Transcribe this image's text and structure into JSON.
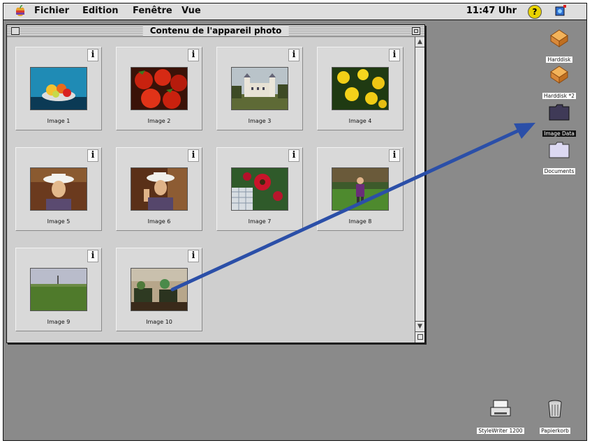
{
  "menubar": {
    "menus": [
      "Fichier",
      "Edition",
      "Fenêtre",
      "Vue"
    ],
    "clock": "11:47 Uhr",
    "help_glyph": "?"
  },
  "window": {
    "title": "Contenu de l'appareil photo",
    "info_glyph": "i",
    "images": [
      {
        "label": "Image 1",
        "scene": "fruit-bowl"
      },
      {
        "label": "Image 2",
        "scene": "strawberries"
      },
      {
        "label": "Image 3",
        "scene": "castle"
      },
      {
        "label": "Image 4",
        "scene": "yellow-flowers"
      },
      {
        "label": "Image 5",
        "scene": "woman-hat"
      },
      {
        "label": "Image 6",
        "scene": "woman-hat-2"
      },
      {
        "label": "Image 7",
        "scene": "red-flowers"
      },
      {
        "label": "Image 8",
        "scene": "girl-garden"
      },
      {
        "label": "Image 9",
        "scene": "field"
      },
      {
        "label": "Image 10",
        "scene": "balcony-plants"
      }
    ]
  },
  "desktop": {
    "icons": [
      {
        "label": "Harddisk",
        "icon": "harddisk-icon"
      },
      {
        "label": "Harddisk *2",
        "icon": "harddisk-icon"
      },
      {
        "label": "Image Data",
        "icon": "folder-icon",
        "selected": true
      },
      {
        "label": "Documents",
        "icon": "folder-icon"
      },
      {
        "label": "StyleWriter 1200",
        "icon": "printer-icon"
      },
      {
        "label": "Papierkorb",
        "icon": "trash-icon"
      }
    ]
  },
  "colors": {
    "desktop": "#8a8a8a",
    "arrow": "#2b4fa8",
    "window": "#cfcfcf"
  }
}
